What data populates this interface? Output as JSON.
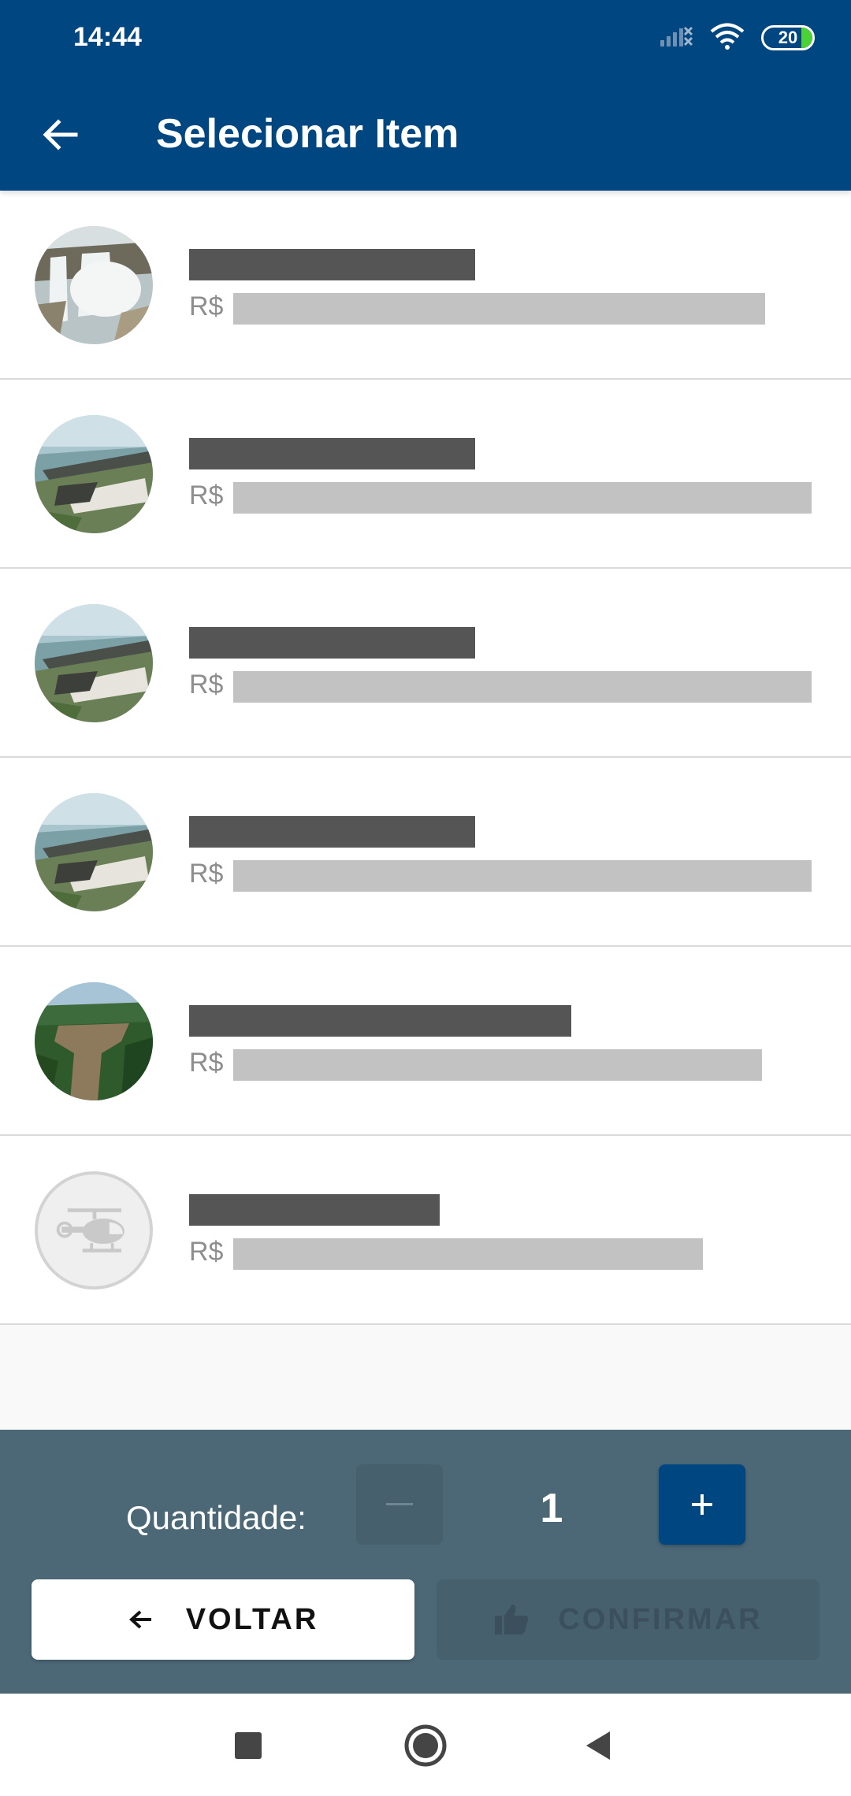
{
  "status_bar": {
    "time": "14:44",
    "battery": "20",
    "icons": [
      "signal-off-icon",
      "wifi-icon",
      "battery-icon"
    ]
  },
  "app_bar": {
    "title": "Selecionar Item",
    "back_icon": "arrow-left-icon"
  },
  "items": [
    {
      "name": "██████████████",
      "price_label": "R$",
      "price": "████████████████████████",
      "thumb": "waterfall"
    },
    {
      "name": "██████████████",
      "price_label": "R$",
      "price": "██████████████████████████",
      "thumb": "dam"
    },
    {
      "name": "██████████████",
      "price_label": "R$",
      "price": "██████████████████████████",
      "thumb": "dam"
    },
    {
      "name": "██████████████",
      "price_label": "R$",
      "price": "██████████████████████████",
      "thumb": "dam"
    },
    {
      "name": "███████████████████",
      "price_label": "R$",
      "price": "████████████████████████",
      "thumb": "river"
    },
    {
      "name": "████████████",
      "price_label": "R$",
      "price": "█████████████████████",
      "thumb": "helicopter-placeholder"
    }
  ],
  "quantity": {
    "label": "Quantidade:",
    "value": "1",
    "minus": "−",
    "plus": "+"
  },
  "actions": {
    "back_label": "VOLTAR",
    "confirm_label": "CONFIRMAR"
  },
  "colors": {
    "primary": "#004681",
    "panel": "#4c6877",
    "disabled": "#46606d"
  }
}
